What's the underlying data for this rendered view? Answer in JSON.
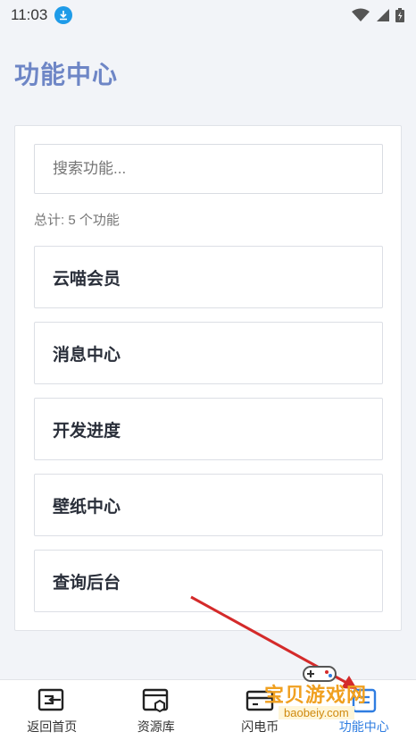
{
  "status_bar": {
    "time": "11:03"
  },
  "header": {
    "title": "功能中心"
  },
  "search": {
    "placeholder": "搜索功能..."
  },
  "summary": {
    "total_text": "总计: 5 个功能"
  },
  "functions": [
    {
      "label": "云喵会员"
    },
    {
      "label": "消息中心"
    },
    {
      "label": "开发进度"
    },
    {
      "label": "壁纸中心"
    },
    {
      "label": "查询后台"
    }
  ],
  "tab_bar": {
    "items": [
      {
        "label": "返回首页",
        "icon": "return-home-icon"
      },
      {
        "label": "资源库",
        "icon": "resource-library-icon"
      },
      {
        "label": "闪电币",
        "icon": "wallet-card-icon"
      },
      {
        "label": "功能中心",
        "icon": "function-center-icon",
        "active": true
      }
    ]
  },
  "watermark": {
    "title": "宝贝游戏网",
    "url": "baobeiy.com"
  },
  "colors": {
    "title": "#6e86c6",
    "active_tab": "#2f7de1",
    "arrow": "#d42a2a"
  }
}
